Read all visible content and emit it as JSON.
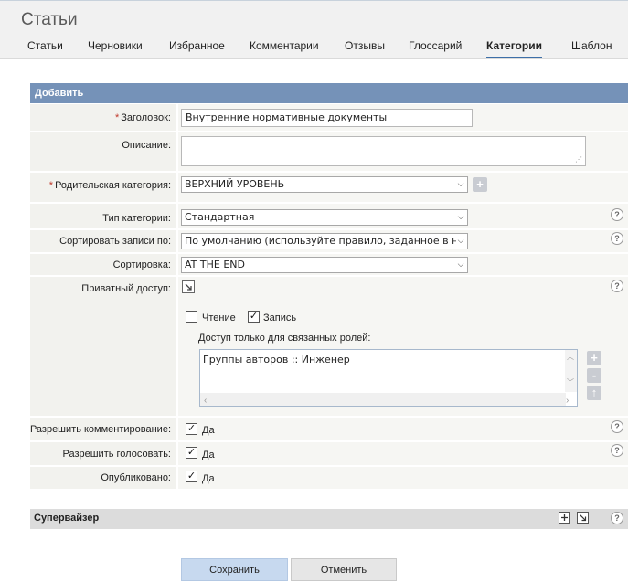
{
  "page": {
    "title": "Статьи"
  },
  "tabs": [
    {
      "label": "Статьи"
    },
    {
      "label": "Черновики"
    },
    {
      "label": "Избранное"
    },
    {
      "label": "Комментарии"
    },
    {
      "label": "Отзывы"
    },
    {
      "label": "Глоссарий"
    },
    {
      "label": "Категории",
      "active": true
    },
    {
      "label": "Шаблон"
    }
  ],
  "form": {
    "section_title": "Добавить",
    "title_label": "Заголовок:",
    "title_value": "Внутренние нормативные документы",
    "description_label": "Описание:",
    "description_value": "",
    "parent_label": "Родительская категория:",
    "parent_value": "ВЕРХНИЙ УРОВЕНЬ",
    "type_label": "Тип категории:",
    "type_value": "Стандартная",
    "sort_records_label": "Сортировать записи по:",
    "sort_records_value": "По умолчанию (используйте правило, заданное в н",
    "order_label": "Сортировка:",
    "order_value": "AT THE END",
    "private_label": "Приватный доступ:",
    "read_label": "Чтение",
    "read_checked": false,
    "write_label": "Запись",
    "write_checked": true,
    "roles_label": "Доступ только для связанных ролей:",
    "roles_value": "Группы авторов :: Инженер",
    "comments_label": "Разрешить комментирование:",
    "comments_value": "Да",
    "voting_label": "Разрешить голосовать:",
    "voting_value": "Да",
    "published_label": "Опубликовано:",
    "published_value": "Да",
    "required_mark": "*",
    "help_glyph": "?",
    "check_glyph": "✓",
    "chevron_glyph": "⌵",
    "plus_glyph": "+",
    "minus_glyph": "-",
    "up_glyph": "↑"
  },
  "supervisor": {
    "title": "Супервайзер"
  },
  "actions": {
    "save_label": "Сохранить",
    "cancel_label": "Отменить"
  },
  "colors": {
    "accent": "#7592b8",
    "save_bg": "#c7d9ef",
    "cancel_bg": "#e6e6e6"
  }
}
